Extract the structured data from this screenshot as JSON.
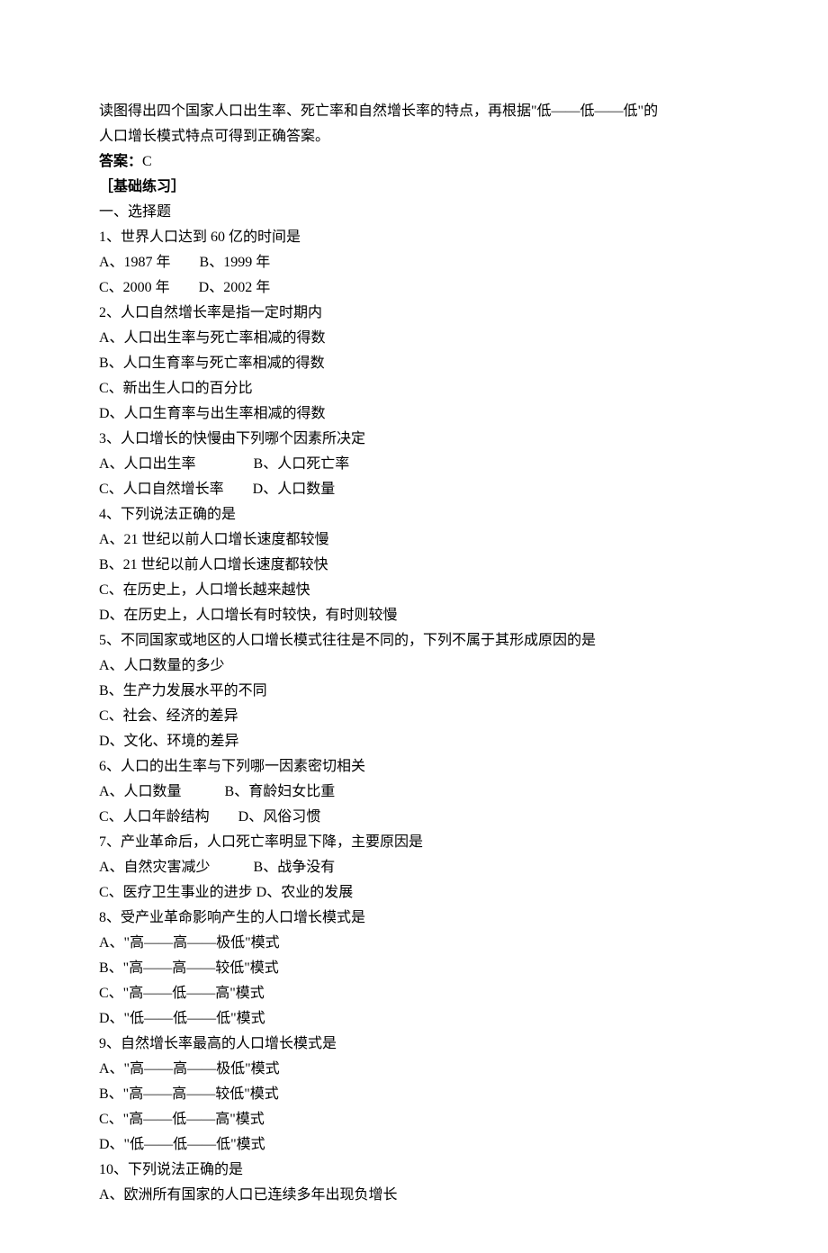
{
  "intro_line1": "读图得出四个国家人口出生率、死亡率和自然增长率的特点，再根据\"低——低——低\"的",
  "intro_line2": "人口增长模式特点可得到正确答案。",
  "answer_label": "答案：",
  "answer_value": "C",
  "section_label": "［基础练习］",
  "part1_title": "一、选择题",
  "questions": [
    {
      "stem": "1、世界人口达到 60 亿的时间是",
      "option_lines": [
        "A、1987 年　　B、1999 年",
        "C、2000 年　　D、2002 年"
      ]
    },
    {
      "stem": "2、人口自然增长率是指一定时期内",
      "option_lines": [
        "A、人口出生率与死亡率相减的得数",
        "B、人口生育率与死亡率相减的得数",
        "C、新出生人口的百分比",
        "D、人口生育率与出生率相减的得数"
      ]
    },
    {
      "stem": "3、人口增长的快慢由下列哪个因素所决定",
      "option_lines": [
        "A、人口出生率　　　　B、人口死亡率",
        "C、人口自然增长率　　D、人口数量"
      ]
    },
    {
      "stem": "4、下列说法正确的是",
      "option_lines": [
        "A、21 世纪以前人口增长速度都较慢",
        "B、21 世纪以前人口增长速度都较快",
        "C、在历史上，人口增长越来越快",
        "D、在历史上，人口增长有时较快，有时则较慢"
      ]
    },
    {
      "stem": "5、不同国家或地区的人口增长模式往往是不同的，下列不属于其形成原因的是",
      "option_lines": [
        "A、人口数量的多少",
        "B、生产力发展水平的不同",
        "C、社会、经济的差异",
        "D、文化、环境的差异"
      ]
    },
    {
      "stem": "6、人口的出生率与下列哪一因素密切相关",
      "option_lines": [
        "A、人口数量　　　B、育龄妇女比重",
        "C、人口年龄结构　　D、风俗习惯"
      ]
    },
    {
      "stem": "7、产业革命后，人口死亡率明显下降，主要原因是",
      "option_lines": [
        "A、自然灾害减少　　　B、战争没有",
        "C、医疗卫生事业的进步 D、农业的发展"
      ]
    },
    {
      "stem": "8、受产业革命影响产生的人口增长模式是",
      "option_lines": [
        "A、\"高——高——极低\"模式",
        "B、\"高——高——较低\"模式",
        "C、\"高——低——高\"模式",
        "D、\"低——低——低\"模式"
      ]
    },
    {
      "stem": "9、自然增长率最高的人口增长模式是",
      "option_lines": [
        "A、\"高——高——极低\"模式",
        "B、\"高——高——较低\"模式",
        "C、\"高——低——高\"模式",
        "D、\"低——低——低\"模式"
      ]
    },
    {
      "stem": "10、下列说法正确的是",
      "option_lines": [
        "A、欧洲所有国家的人口已连续多年出现负增长"
      ]
    }
  ]
}
